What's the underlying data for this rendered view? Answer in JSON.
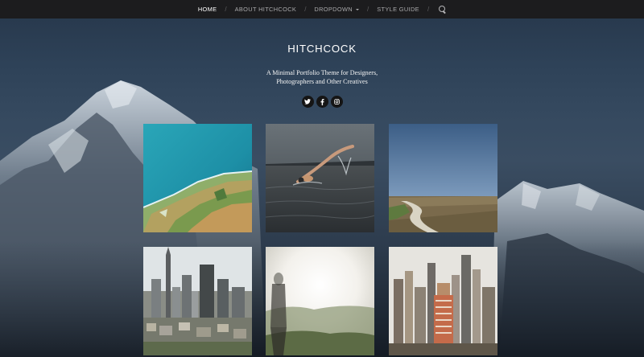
{
  "nav": {
    "items": [
      {
        "label": "HOME",
        "active": true
      },
      {
        "label": "ABOUT HITCHCOCK",
        "active": false
      },
      {
        "label": "DROPDOWN",
        "active": false,
        "has_submenu": true
      },
      {
        "label": "STYLE GUIDE",
        "active": false
      }
    ],
    "separator": "/",
    "search_icon": "search-icon"
  },
  "header": {
    "title": "HITCHCOCK",
    "description_line1": "A Minimal Portfolio Theme for Designers,",
    "description_line2": "Photographers and Other Creatives"
  },
  "socials": [
    {
      "icon": "twitter-icon"
    },
    {
      "icon": "facebook-icon"
    },
    {
      "icon": "instagram-icon"
    }
  ],
  "colors": {
    "nav_bg": "#1c1c1e",
    "nav_active": "#ffffff",
    "nav_text": "#a9a9ab",
    "social_bg": "#151515"
  }
}
